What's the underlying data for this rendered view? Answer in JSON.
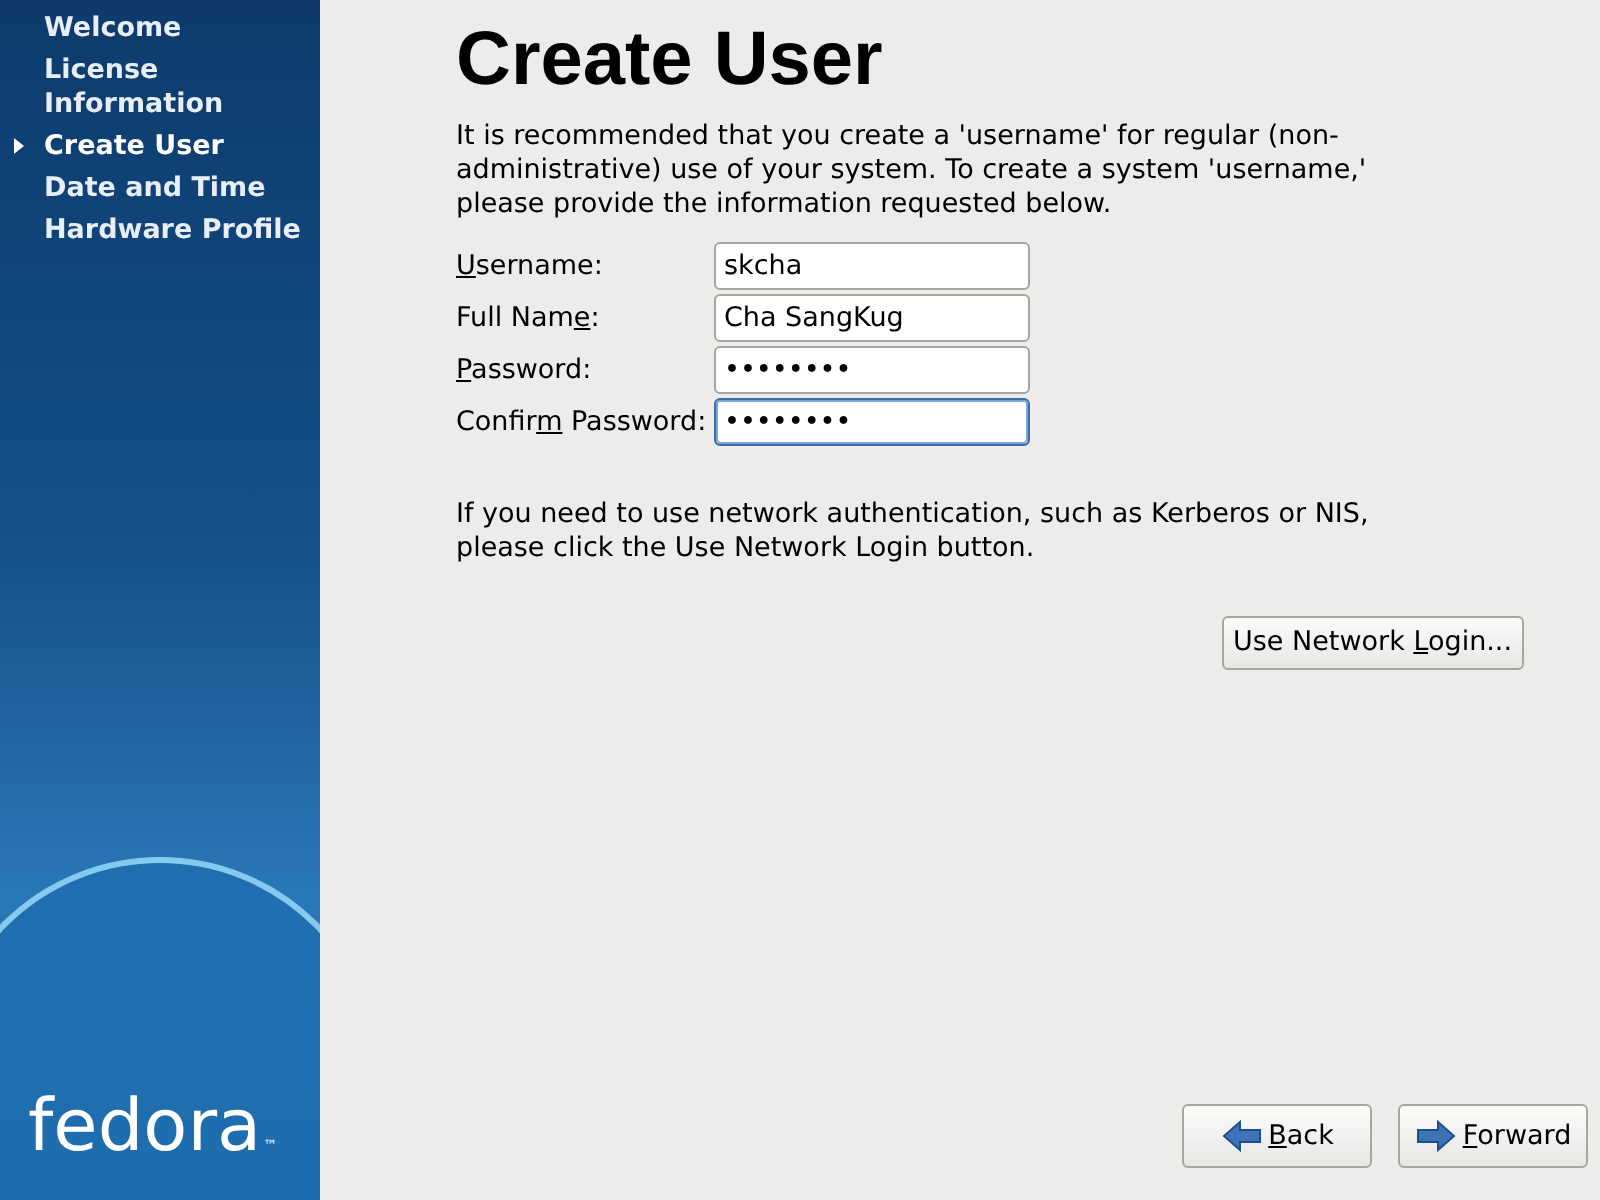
{
  "sidebar": {
    "items": [
      {
        "label": "Welcome",
        "selected": false
      },
      {
        "label": "License Information",
        "selected": false
      },
      {
        "label": "Create User",
        "selected": true
      },
      {
        "label": "Date and Time",
        "selected": false
      },
      {
        "label": "Hardware Profile",
        "selected": false
      }
    ],
    "logo": {
      "text": "fedora",
      "trademark": "™"
    }
  },
  "title": "Create User",
  "intro": "It is recommended that you create a 'username' for regular (non-administrative) use of your system. To create a system 'username,' please provide the information requested below.",
  "fields": [
    {
      "label": {
        "key": "U",
        "after": "sername:"
      },
      "value": "skcha",
      "focused": false
    },
    {
      "label": {
        "before": "Full Nam",
        "key": "e",
        "after": ":"
      },
      "value": "Cha SangKug",
      "focused": false
    },
    {
      "label": {
        "key": "P",
        "after": "assword:"
      },
      "value": "••••••••",
      "focused": false
    },
    {
      "label": {
        "before": "Confir",
        "key": "m",
        "after": " Password:"
      },
      "value": "••••••••",
      "focused": true
    }
  ],
  "network_note": "If you need to use network authentication, such as Kerberos or NIS, please click the Use Network Login button.",
  "network_button": {
    "before": "Use Network ",
    "key": "L",
    "after": "ogin..."
  },
  "nav_buttons": [
    {
      "kind": "back",
      "label": {
        "key": "B",
        "after": "ack"
      }
    },
    {
      "kind": "forward",
      "label": {
        "key": "F",
        "after": "orward"
      }
    }
  ]
}
